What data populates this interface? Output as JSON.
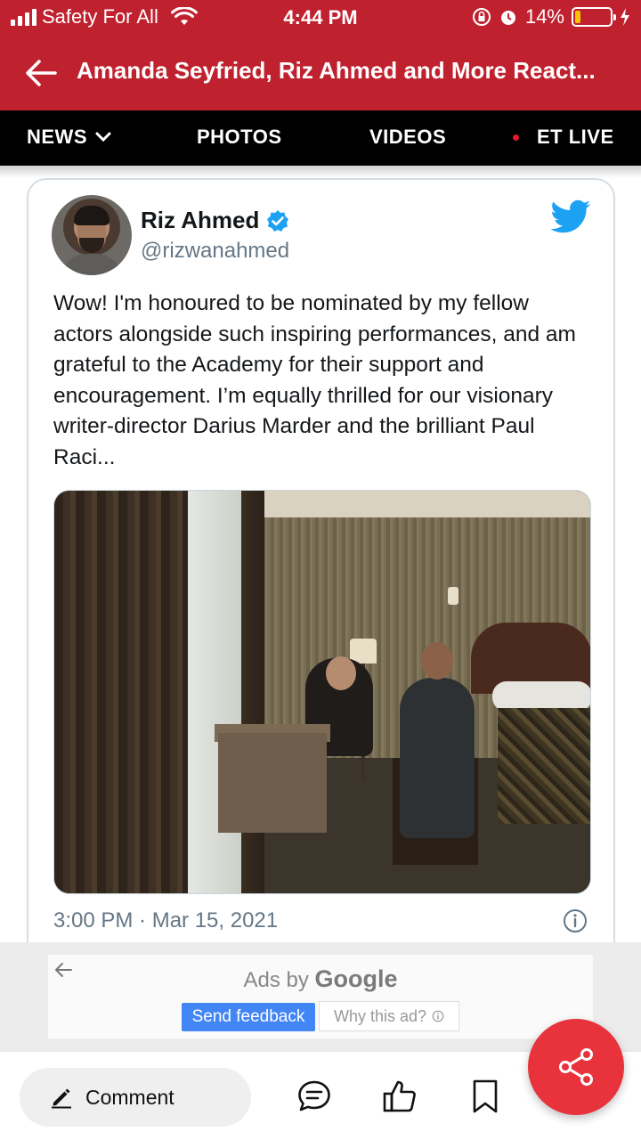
{
  "status_bar": {
    "carrier": "Safety For All",
    "time": "4:44 PM",
    "battery": "14%",
    "battery_level": 0.14,
    "battery_color": "#f5c400"
  },
  "app_bar": {
    "title": "Amanda Seyfried, Riz Ahmed and More React...",
    "back_icon": "arrow-left-icon",
    "color": "#c0212f"
  },
  "nav": {
    "items": [
      {
        "label": "NEWS"
      },
      {
        "label": "PHOTOS"
      },
      {
        "label": "VIDEOS"
      },
      {
        "label": "ET LIVE"
      }
    ]
  },
  "tweet": {
    "author": "Riz Ahmed",
    "handle": "@rizwanahmed",
    "text": "Wow! I'm honoured to be nominated by my fellow actors alongside such inspiring performances, and am grateful to the Academy for their support and encouragement. I’m equally thrilled for our visionary writer-director Darius Marder and the brilliant Paul Raci...",
    "timestamp": "3:00 PM · Mar 15, 2021",
    "icons": [
      "verified-badge-icon",
      "twitter-bird-icon",
      "info-icon"
    ],
    "accent": "#1da1f2"
  },
  "ad": {
    "ads_by": "Ads by",
    "google": "Google",
    "feedback": "Send feedback",
    "why": "Why this ad?"
  },
  "bottom": {
    "comment": "Comment",
    "icons": [
      "pencil-icon",
      "chat-bubble-icon",
      "thumbs-up-icon",
      "bookmark-icon",
      "share-icon"
    ],
    "fab_color": "#e8333d"
  }
}
